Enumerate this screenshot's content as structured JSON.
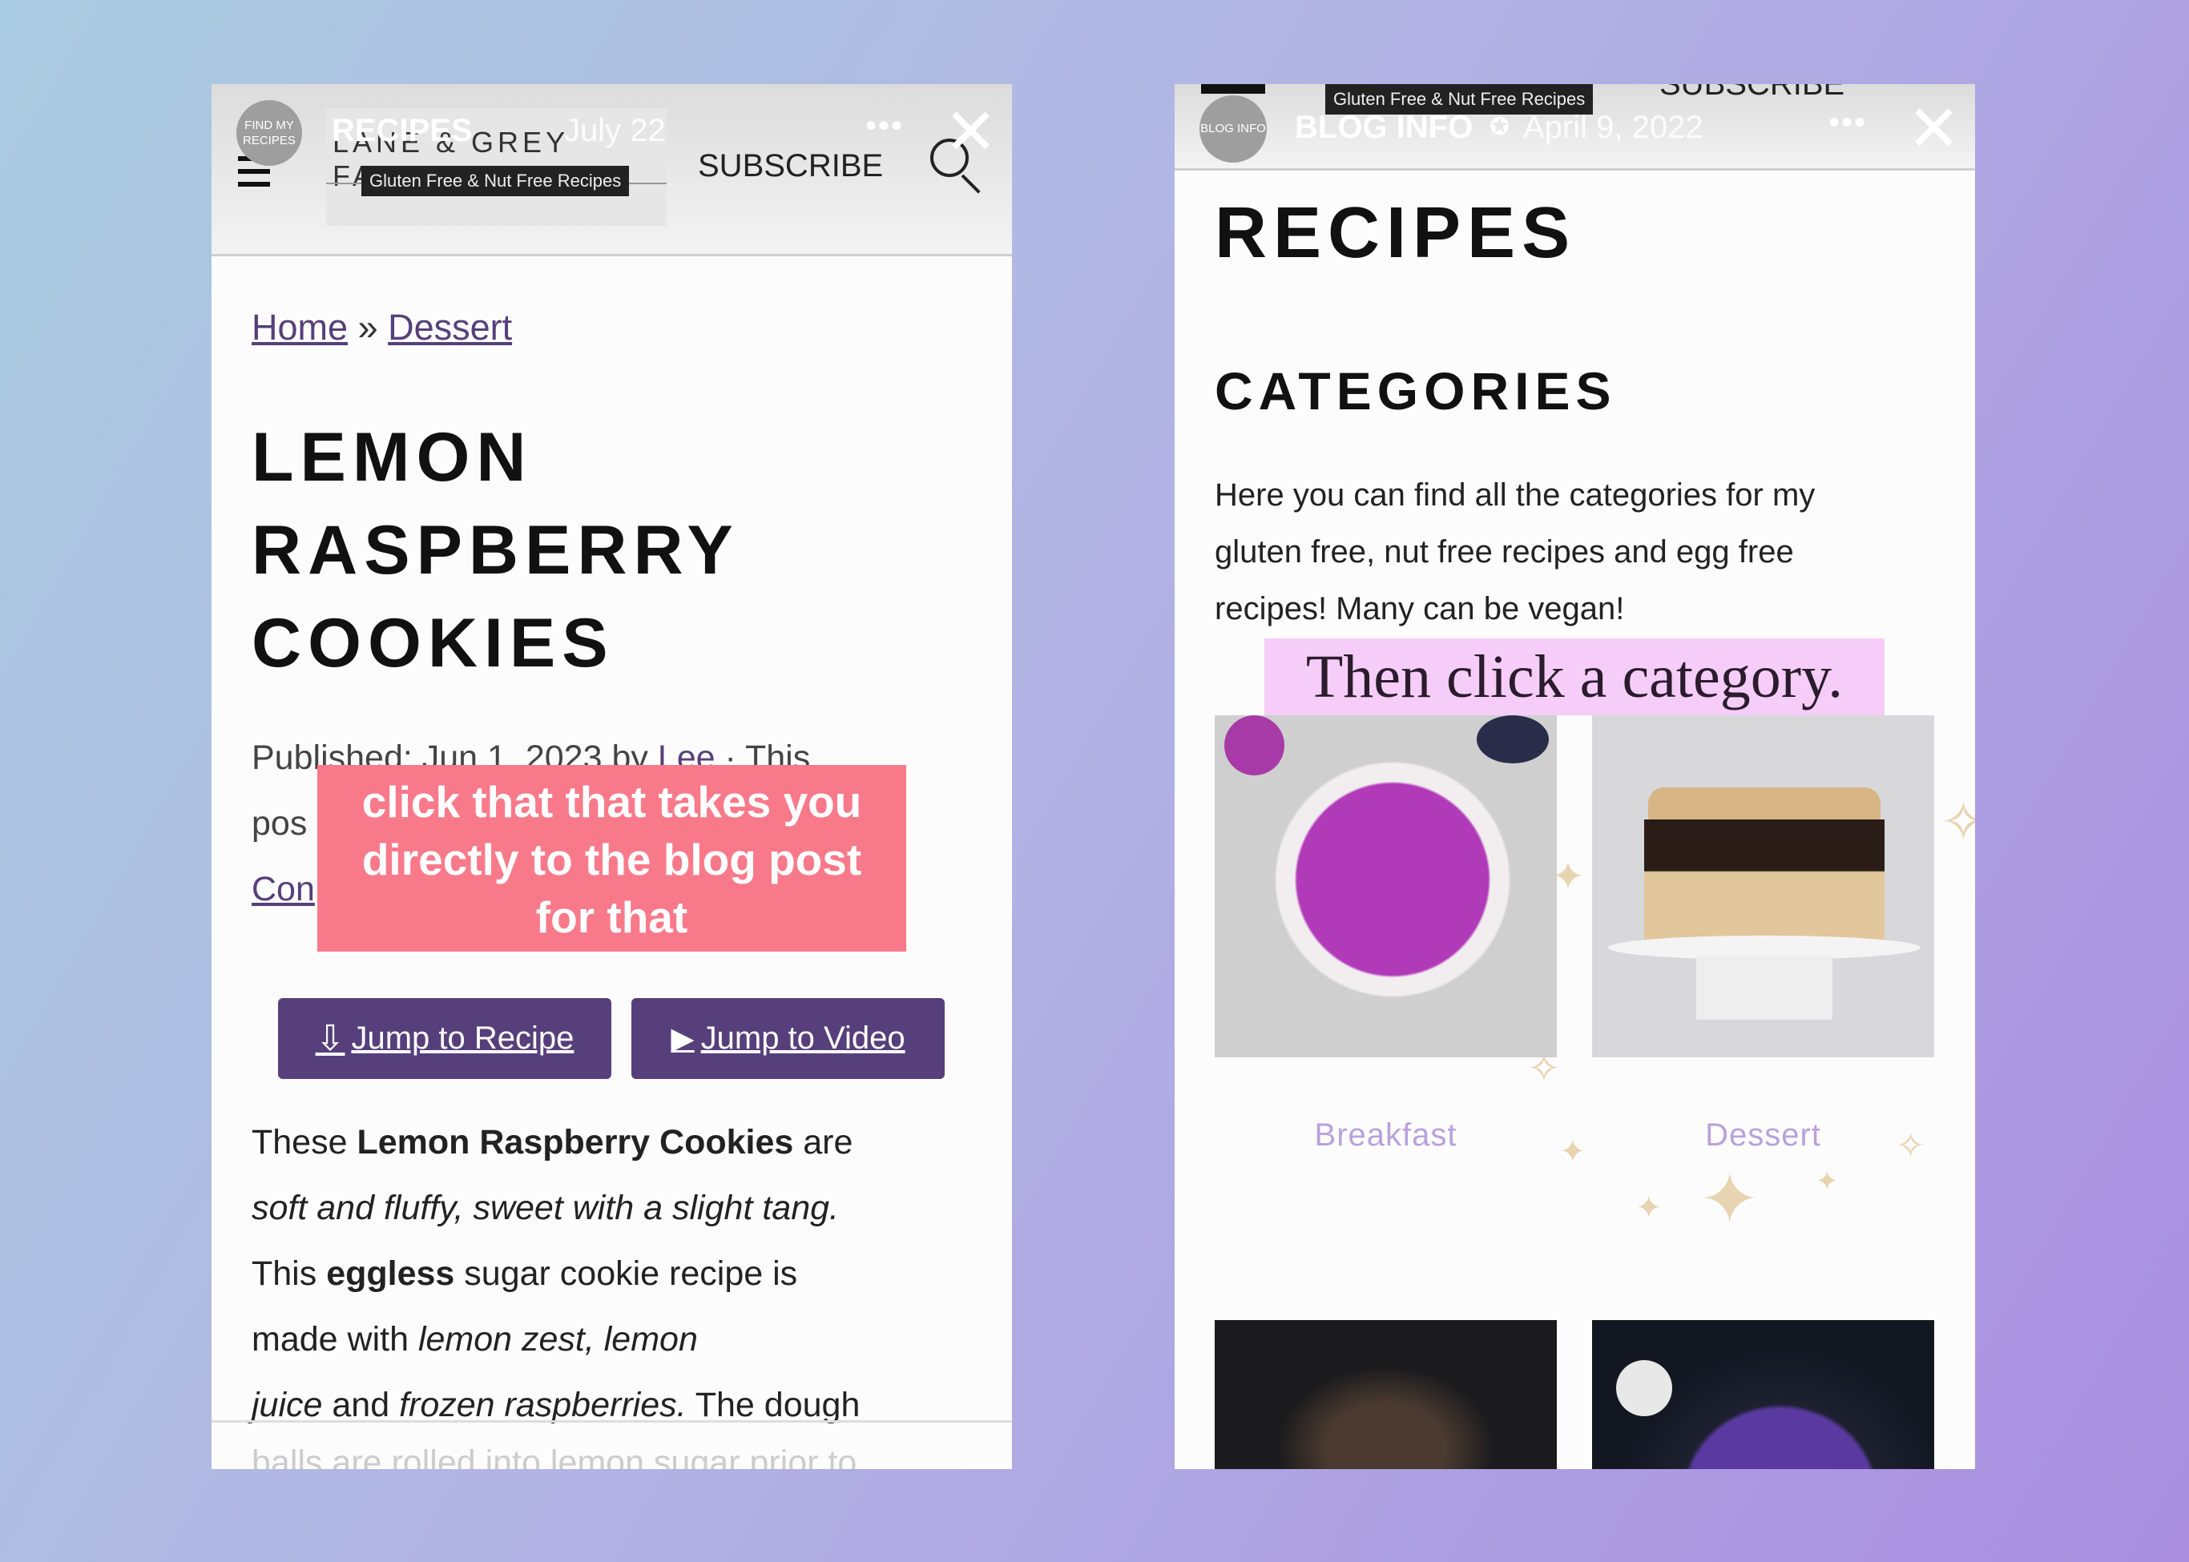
{
  "left_story": {
    "avatar_text": "FIND MY RECIPES",
    "story_name": "RECIPES",
    "story_date": "July 22",
    "more_icon": "ellipsis-icon",
    "close_icon": "close-icon",
    "site": {
      "logo": "LANE & GREY FARE",
      "tagline": "Gluten Free & Nut Free Recipes",
      "subscribe": "SUBSCRIBE"
    },
    "breadcrumb": {
      "home": "Home",
      "sep": "»",
      "current": "Dessert"
    },
    "title_lines": [
      "LEMON",
      "RASPBERRY",
      "COOKIES"
    ],
    "meta_line": "Published: Jun 1, 2023 by ",
    "meta_author": "Lee",
    "meta_tail": " · This",
    "meta_line2": "pos",
    "meta_link": "Con",
    "overlay_text": "click that that takes you directly to the blog post for that",
    "buttons": {
      "recipe": "Jump to Recipe",
      "video": "Jump to Video"
    },
    "body": {
      "l1a": "These ",
      "l1b": "Lemon Raspberry Cookies",
      "l1c": " are",
      "l2": "soft and fluffy, sweet with a slight tang.",
      "l3a": "This ",
      "l3b": "eggless",
      "l3c": " sugar cookie recipe is",
      "l4a": "made with ",
      "l4b": "lemon zest, lemon",
      "l5a": "juice",
      "l5b": " and ",
      "l5c": "frozen raspberries.",
      "l5d": " The dough",
      "l6": "balls are rolled into lemon sugar prior to"
    }
  },
  "right_story": {
    "avatar_text": "BLOG INFO",
    "story_name": "BLOG INFO",
    "story_date": "April 9, 2022",
    "tagline": "Gluten Free & Nut Free Recipes",
    "subscribe": "SUBSCRIBE",
    "page_title": "RECIPES",
    "section_title": "CATEGORIES",
    "intro_lines": [
      "Here you can find all the categories for my",
      "gluten free, nut free recipes and egg free",
      "recipes! Many can be vegan!"
    ],
    "overlay_text": "Then click a category.",
    "categories": [
      {
        "label": "Breakfast"
      },
      {
        "label": "Dessert"
      }
    ]
  },
  "colors": {
    "link": "#55407a",
    "button": "#563f7a",
    "overlay_pink": "#f87a8a",
    "overlay_lavender": "#f6cdf8",
    "category_label": "#b8a2dc"
  }
}
